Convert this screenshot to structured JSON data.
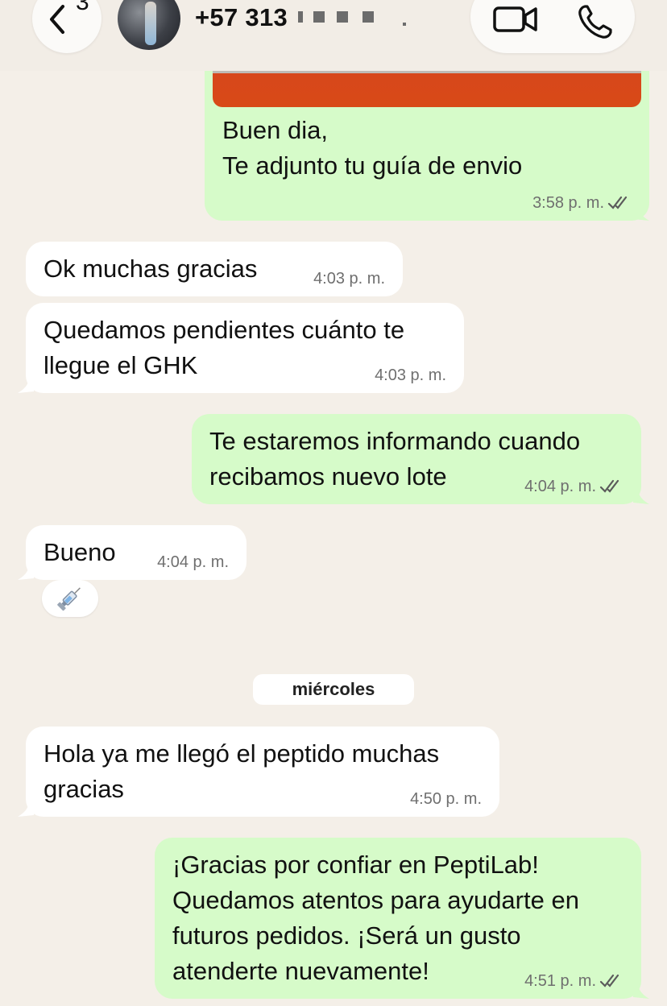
{
  "header": {
    "back_count": "3",
    "contact_name": "+57 313",
    "icons": {
      "back": "chevron-left-icon",
      "video": "video-camera-icon",
      "call": "phone-icon"
    }
  },
  "messages": [
    {
      "direction": "out",
      "text": "Buen dia,\nTe adjunto tu guía de envio",
      "time": "3:58 p. m.",
      "status": "read"
    },
    {
      "direction": "in",
      "text": "Ok muchas gracias",
      "time": "4:03 p. m."
    },
    {
      "direction": "in",
      "text": "Quedamos pendientes cuánto te\nllegue el GHK",
      "time": "4:03 p. m."
    },
    {
      "direction": "out",
      "text": "Te estaremos informando cuando\nrecibamos nuevo lote",
      "time": "4:04 p. m.",
      "status": "read"
    },
    {
      "direction": "in",
      "text": "Bueno",
      "time": "4:04 p. m.",
      "reaction": "syringe-emoji"
    },
    {
      "direction": "in",
      "text": "Hola ya me llegó el peptido muchas\ngracias",
      "time": "4:50 p. m."
    },
    {
      "direction": "out",
      "text": "¡Gracias por confiar en PeptiLab!\nQuedamos atentos para ayudarte en\nfuturos pedidos. ¡Será un gusto\natenderte nuevamente!",
      "time": "4:51 p. m.",
      "status": "read"
    }
  ],
  "date_separator": "miércoles",
  "colors": {
    "outgoing": "#d6fbc9",
    "incoming": "#ffffff",
    "background": "#f4efe8",
    "read_check": "#5b5b5b"
  }
}
